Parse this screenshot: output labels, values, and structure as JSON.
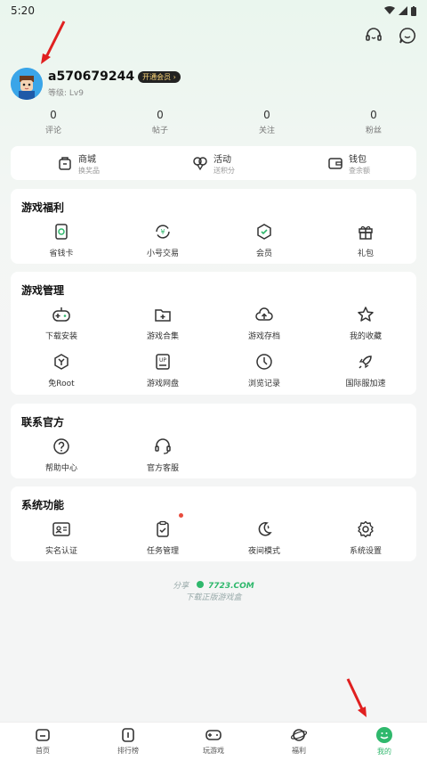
{
  "status_bar": {
    "time": "5:20"
  },
  "profile": {
    "username": "a570679244",
    "vip_badge": "开通会员 ›",
    "level": "等级: Lv9"
  },
  "stats": [
    {
      "value": "0",
      "label": "评论"
    },
    {
      "value": "0",
      "label": "帖子"
    },
    {
      "value": "0",
      "label": "关注"
    },
    {
      "value": "0",
      "label": "粉丝"
    }
  ],
  "quick_links": [
    {
      "title": "商城",
      "sub": "换奖品",
      "icon": "shop-icon"
    },
    {
      "title": "活动",
      "sub": "送积分",
      "icon": "balloon-icon"
    },
    {
      "title": "钱包",
      "sub": "查余额",
      "icon": "wallet-icon"
    }
  ],
  "benefits": {
    "title": "游戏福利",
    "items": [
      {
        "label": "省钱卡",
        "icon": "card-icon"
      },
      {
        "label": "小号交易",
        "icon": "yen-exchange-icon"
      },
      {
        "label": "会员",
        "icon": "vip-icon"
      },
      {
        "label": "礼包",
        "icon": "gift-icon"
      }
    ]
  },
  "manage": {
    "title": "游戏管理",
    "items": [
      {
        "label": "下载安装",
        "icon": "gamepad-icon"
      },
      {
        "label": "游戏合集",
        "icon": "folder-plus-icon"
      },
      {
        "label": "游戏存档",
        "icon": "cloud-upload-icon"
      },
      {
        "label": "我的收藏",
        "icon": "star-icon"
      },
      {
        "label": "免Root",
        "icon": "shield-y-icon"
      },
      {
        "label": "游戏网盘",
        "icon": "disk-up-icon"
      },
      {
        "label": "浏览记录",
        "icon": "clock-icon"
      },
      {
        "label": "国际服加速",
        "icon": "rocket-icon"
      }
    ]
  },
  "contact": {
    "title": "联系官方",
    "items": [
      {
        "label": "帮助中心",
        "icon": "help-icon"
      },
      {
        "label": "官方客服",
        "icon": "headset-icon"
      }
    ]
  },
  "system": {
    "title": "系统功能",
    "items": [
      {
        "label": "实名认证",
        "icon": "id-card-icon"
      },
      {
        "label": "任务管理",
        "icon": "clipboard-icon"
      },
      {
        "label": "夜间模式",
        "icon": "moon-icon"
      },
      {
        "label": "系统设置",
        "icon": "gear-icon"
      }
    ]
  },
  "share": {
    "prefix": "分享",
    "brand": "7723.COM",
    "tagline": "下载正版游戏盒"
  },
  "bottom_nav": [
    {
      "label": "首页",
      "icon": "home-icon"
    },
    {
      "label": "排行榜",
      "icon": "ranking-icon"
    },
    {
      "label": "玩游戏",
      "icon": "gamepad-nav-icon"
    },
    {
      "label": "福利",
      "icon": "planet-icon"
    },
    {
      "label": "我的",
      "icon": "me-icon"
    }
  ],
  "colors": {
    "accent": "#2fb86c",
    "annotation_arrow": "#e02020"
  }
}
